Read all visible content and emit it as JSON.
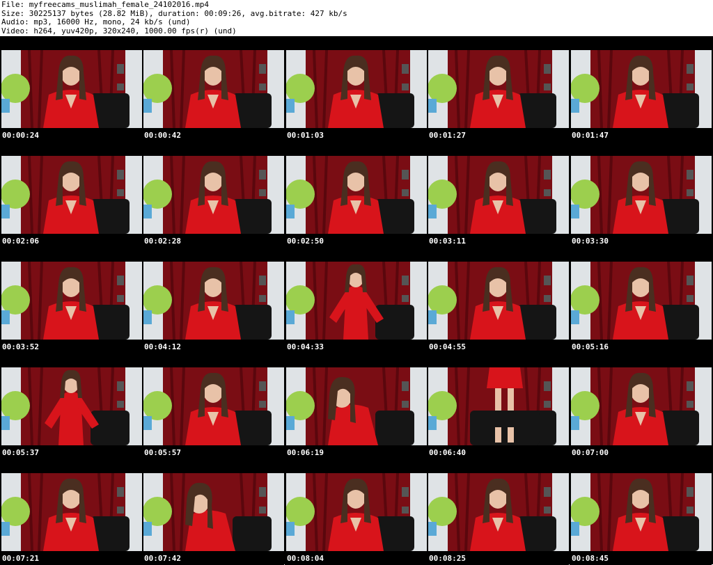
{
  "header": {
    "file_line": "File: myfreecams_muslimah_female_24102016.mp4",
    "size_line": "Size: 30225137 bytes (28.82 MiB), duration: 00:09:26, avg.bitrate: 427 kb/s",
    "audio_line": "Audio: mp3, 16000 Hz, mono, 24 kb/s (und)",
    "video_line": "Video: h264, yuv420p, 320x240, 1000.00 fps(r) (und)"
  },
  "colors": {
    "sheet_bg": "#000000",
    "curtain": "#7a0d14",
    "dress": "#d8141b",
    "lantern": "#9ccf4e",
    "chair": "#151515",
    "wall": "#dfe3e6"
  },
  "thumbnails": [
    {
      "timestamp": "00:00:24",
      "pose": "seated"
    },
    {
      "timestamp": "00:00:42",
      "pose": "seated"
    },
    {
      "timestamp": "00:01:03",
      "pose": "seated"
    },
    {
      "timestamp": "00:01:27",
      "pose": "seated"
    },
    {
      "timestamp": "00:01:47",
      "pose": "seated"
    },
    {
      "timestamp": "00:02:06",
      "pose": "seated"
    },
    {
      "timestamp": "00:02:28",
      "pose": "seated"
    },
    {
      "timestamp": "00:02:50",
      "pose": "seated"
    },
    {
      "timestamp": "00:03:11",
      "pose": "seated"
    },
    {
      "timestamp": "00:03:30",
      "pose": "seated"
    },
    {
      "timestamp": "00:03:52",
      "pose": "seated"
    },
    {
      "timestamp": "00:04:12",
      "pose": "seated"
    },
    {
      "timestamp": "00:04:33",
      "pose": "standing"
    },
    {
      "timestamp": "00:04:55",
      "pose": "seated"
    },
    {
      "timestamp": "00:05:16",
      "pose": "seated"
    },
    {
      "timestamp": "00:05:37",
      "pose": "standing"
    },
    {
      "timestamp": "00:05:57",
      "pose": "seated"
    },
    {
      "timestamp": "00:06:19",
      "pose": "leaning"
    },
    {
      "timestamp": "00:06:40",
      "pose": "legs"
    },
    {
      "timestamp": "00:07:00",
      "pose": "seated"
    },
    {
      "timestamp": "00:07:21",
      "pose": "seated"
    },
    {
      "timestamp": "00:07:42",
      "pose": "leaning"
    },
    {
      "timestamp": "00:08:04",
      "pose": "seated"
    },
    {
      "timestamp": "00:08:25",
      "pose": "seated"
    },
    {
      "timestamp": "00:08:45",
      "pose": "seated"
    }
  ]
}
